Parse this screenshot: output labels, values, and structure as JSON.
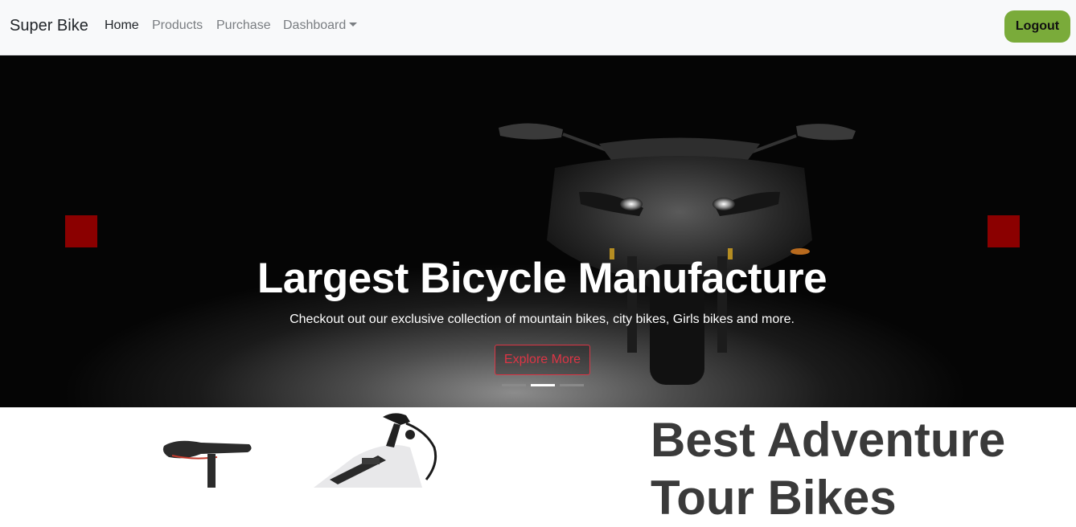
{
  "navbar": {
    "brand": "Super Bike",
    "links": [
      {
        "label": "Home",
        "active": true
      },
      {
        "label": "Products",
        "active": false
      },
      {
        "label": "Purchase",
        "active": false
      },
      {
        "label": "Dashboard",
        "active": false,
        "dropdown": true
      }
    ],
    "logout_label": "Logout",
    "logout_color": "#7aab3a"
  },
  "carousel": {
    "slide": {
      "title": "Largest Bicycle Manufacture",
      "subtitle": "Checkout out our exclusive collection of mountain bikes, city bikes, Girls bikes and more.",
      "button_label": "Explore More"
    },
    "slide_count": 3,
    "active_index": 1,
    "control_color": "#8b0000",
    "button_color": "#dc3545"
  },
  "section": {
    "heading": "Best Adventure Tour Bikes"
  }
}
